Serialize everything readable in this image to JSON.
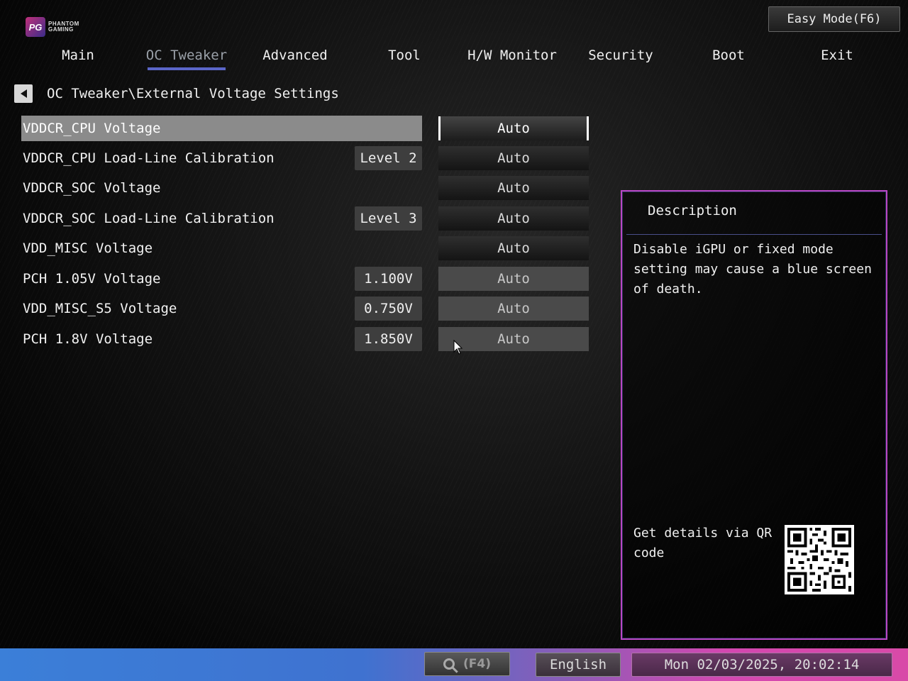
{
  "header": {
    "logo_text": [
      "PHANTOM",
      "GAMING"
    ],
    "easy_mode_label": "Easy Mode(F6)"
  },
  "nav": {
    "tabs": [
      {
        "label": "Main",
        "active": false
      },
      {
        "label": "OC Tweaker",
        "active": true
      },
      {
        "label": "Advanced",
        "active": false
      },
      {
        "label": "Tool",
        "active": false
      },
      {
        "label": "H/W Monitor",
        "active": false
      },
      {
        "label": "Security",
        "active": false
      },
      {
        "label": "Boot",
        "active": false
      },
      {
        "label": "Exit",
        "active": false
      }
    ]
  },
  "breadcrumb": "OC Tweaker\\External Voltage Settings",
  "settings": [
    {
      "label": "VDDCR_CPU Voltage",
      "value": "",
      "option": "Auto"
    },
    {
      "label": "VDDCR_CPU Load-Line Calibration",
      "value": "Level 2",
      "option": "Auto"
    },
    {
      "label": "VDDCR_SOC Voltage",
      "value": "",
      "option": "Auto"
    },
    {
      "label": "VDDCR_SOC Load-Line Calibration",
      "value": "Level 3",
      "option": "Auto"
    },
    {
      "label": "VDD_MISC Voltage",
      "value": "",
      "option": "Auto"
    },
    {
      "label": "PCH 1.05V Voltage",
      "value": "1.100V",
      "option": "Auto"
    },
    {
      "label": "VDD_MISC_S5 Voltage",
      "value": "0.750V",
      "option": "Auto"
    },
    {
      "label": "PCH 1.8V Voltage",
      "value": "1.850V",
      "option": "Auto"
    }
  ],
  "description": {
    "title": "Description",
    "body": "Disable iGPU or fixed mode setting may cause a blue screen of death.",
    "qr_text": "Get details via QR code"
  },
  "statusbar": {
    "search_key": "(F4)",
    "language": "English",
    "datetime": "Mon 02/03/2025, 20:02:14"
  },
  "colors": {
    "accent_underline": "#5b66c8",
    "description_border": "#b946c4",
    "status_left": "#3b7fd8",
    "status_right": "#d84aa8"
  },
  "icons": {
    "back": "chevron-left-icon",
    "search": "search-icon",
    "cursor": "mouse-pointer-icon"
  }
}
